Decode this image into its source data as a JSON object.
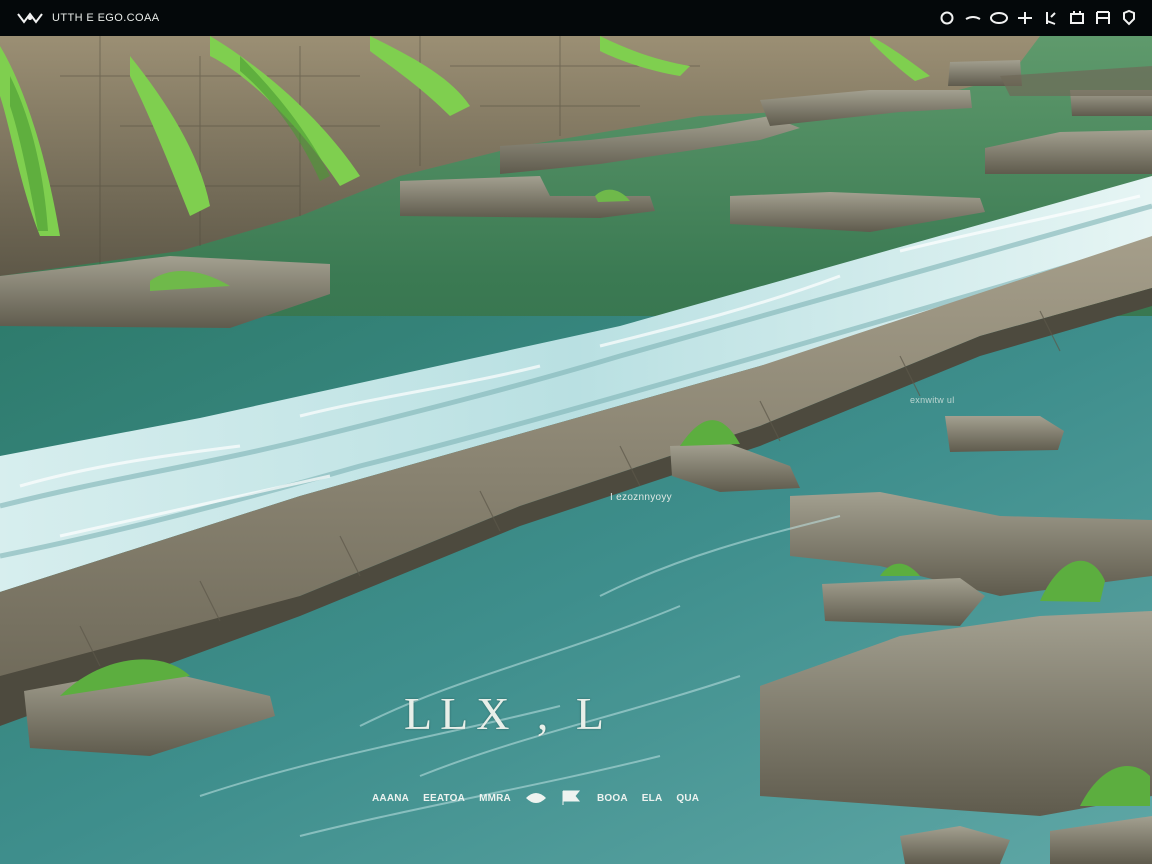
{
  "app": {
    "title": "UTTH E EGO.COAA"
  },
  "toolbar": {
    "icons": [
      "circle-icon",
      "minus-icon",
      "ellipse-icon",
      "plus-cross-icon",
      "flag-icon",
      "box-icon",
      "grid-icon",
      "shield-icon"
    ]
  },
  "overlay": {
    "title": "LLX  ,  L",
    "caption": "I  ezoznnyoyy",
    "note": "exnwitw ul"
  },
  "nav": {
    "items": [
      "AAANA",
      "EEATOA",
      "MMRA",
      "BOOA",
      "ELA",
      "QUA"
    ]
  },
  "colors": {
    "topbar": "#04080a",
    "water_green": "#3f7a55",
    "water_teal": "#3e8e8c",
    "rapids": "#cfe9ea",
    "stone": "#8c8776",
    "grass": "#6fb94a"
  }
}
